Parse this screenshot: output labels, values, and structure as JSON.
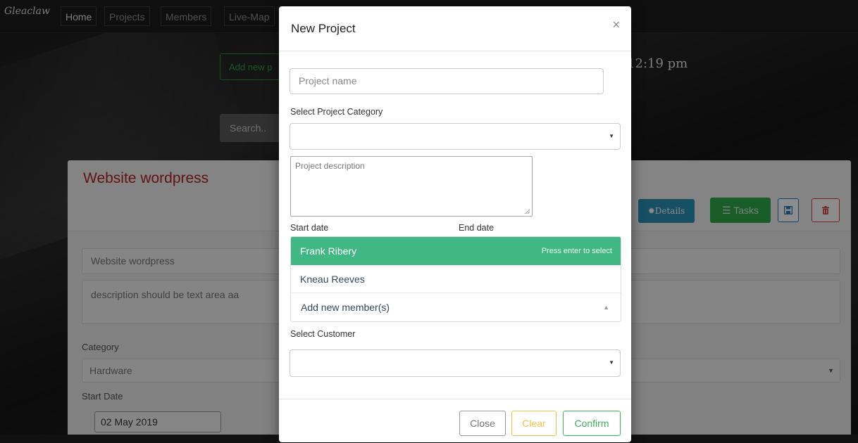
{
  "app": {
    "logo": "Gleaclaw",
    "nav": [
      {
        "label": "Home"
      },
      {
        "label": "Projects"
      },
      {
        "label": "Members"
      },
      {
        "label": "Live-Map"
      }
    ],
    "add_new_label": "Add new p",
    "search_placeholder": "Search..",
    "clock": ":12:19 pm"
  },
  "project_card": {
    "title": "Website wordpress",
    "details_label": "Details",
    "tasks_label": "Tasks",
    "name_value": "Website wordpress",
    "description_value": "description should be text area aa",
    "category_label": "Category",
    "category_value": "Hardware",
    "start_date_label": "Start Date",
    "start_date_value": "02 May 2019"
  },
  "modal": {
    "title": "New Project",
    "close_symbol": "×",
    "project_name_placeholder": "Project name",
    "category_label": "Select Project Category",
    "category_value": "",
    "description_placeholder": "Project description",
    "start_date_label": "Start date",
    "end_date_label": "End date",
    "members": {
      "options": [
        {
          "name": "Frank Ribery",
          "hint": "Press enter to select",
          "highlighted": true
        },
        {
          "name": "Kneau Reeves",
          "highlighted": false
        }
      ],
      "search_label": "Add new member(s)"
    },
    "customer_label": "Select Customer",
    "customer_value": "",
    "footer": {
      "close_label": "Close",
      "clear_label": "Clear",
      "confirm_label": "Confirm"
    }
  },
  "colors": {
    "accent_green": "#41b883",
    "title_red": "#b32424",
    "details_blue": "#2a91b8",
    "tasks_green": "#2ea84a",
    "clear_yellow": "#f0c24a",
    "confirm_green": "#3db35a"
  },
  "icons": {
    "details": "gear-icon",
    "tasks": "list-icon",
    "save": "floppy-disk-icon",
    "delete": "trash-icon",
    "close": "close-icon",
    "dropdown": "caret-down-icon",
    "collapse": "caret-up-icon"
  }
}
